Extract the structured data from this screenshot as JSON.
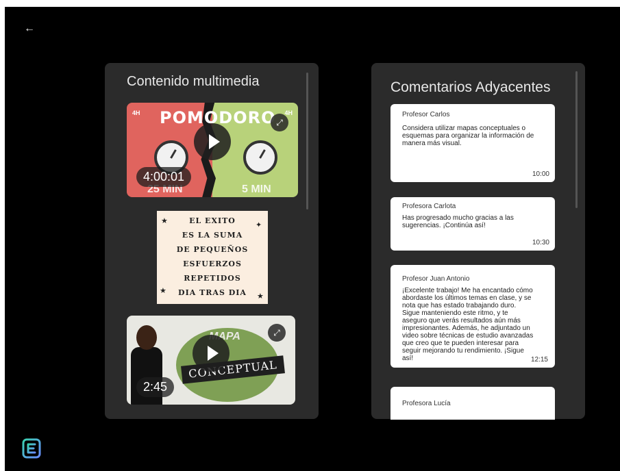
{
  "nav": {
    "back_icon": "arrow-left-icon",
    "back_glyph": "←"
  },
  "media_panel": {
    "title": "Contenido multimedia",
    "items": [
      {
        "type": "video",
        "title_text": "POMODORO",
        "tag_left": "4H",
        "tag_right": "4H",
        "left_minutes": "25 MIN",
        "right_minutes": "5 MIN",
        "duration": "4:00:01"
      },
      {
        "type": "image",
        "lines": [
          "EL EXITO",
          "ES LA SUMA",
          "DE PEQUEÑOS",
          "ESFUERZOS",
          "REPETIDOS",
          "DIA TRAS DIA"
        ]
      },
      {
        "type": "video",
        "title_text": "MAPA",
        "banner_text": "CONCEPTUAL",
        "duration": "2:45"
      }
    ]
  },
  "comments_panel": {
    "title": "Comentarios Adyacentes",
    "comments": [
      {
        "author": "Profesor Carlos",
        "text": "Considera utilizar mapas conceptuales o esquemas para organizar la información de manera más visual.",
        "time": "10:00"
      },
      {
        "author": "Profesora Carlota",
        "text": "Has progresado mucho gracias a las sugerencias. ¡Continúa así!",
        "time": "10:30"
      },
      {
        "author": "Profesor Juan Antonio",
        "text": "¡Excelente trabajo! Me ha encantado cómo abordaste los últimos temas en clase, y se nota que has estado trabajando duro. Sigue manteniendo este ritmo, y te aseguro que verás resultados aún más impresionantes. Además, he adjuntado un video sobre técnicas de estudio avanzadas que creo que te pueden interesar para seguir mejorando tu rendimiento. ¡Sigue así!",
        "time": "12:15"
      },
      {
        "author": "Profesora Lucía",
        "text": "",
        "time": ""
      }
    ]
  },
  "colors": {
    "background": "#000000",
    "panel": "#2b2b2b",
    "card": "#ffffff",
    "pomodoro_red": "#e0645e",
    "pomodoro_green": "#b8d27a",
    "logo_gradient_start": "#3ad1b0",
    "logo_gradient_end": "#6a8cff"
  },
  "icons": {
    "play": "play-icon",
    "expand": "expand-icon",
    "logo": "app-logo-icon"
  }
}
